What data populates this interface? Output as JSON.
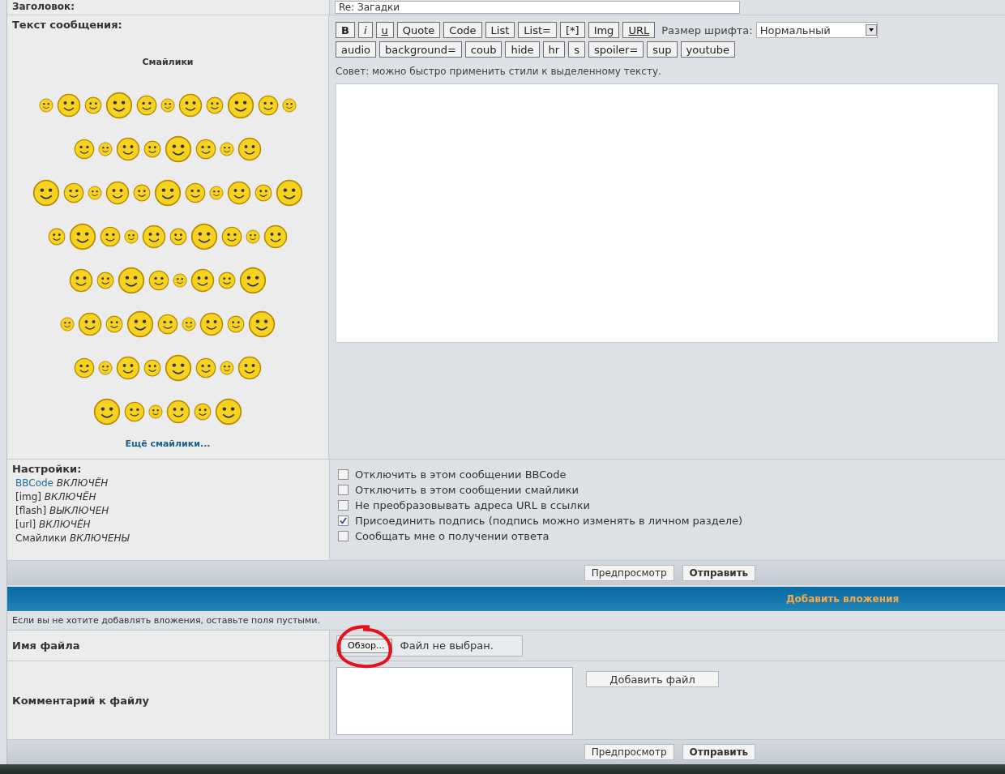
{
  "title_row": {
    "label": "Заголовок:",
    "value": "Re: Загадки"
  },
  "message": {
    "label": "Текст сообщения:",
    "smileys_heading": "Смайлики",
    "more_smileys": "Ещё смайлики...",
    "toolbar_rows": [
      [
        {
          "label": "B",
          "kind": "bold"
        },
        {
          "label": "i",
          "kind": "italic"
        },
        {
          "label": "u",
          "kind": "underline"
        },
        {
          "label": "Quote",
          "kind": "plain"
        },
        {
          "label": "Code",
          "kind": "plain"
        },
        {
          "label": "List",
          "kind": "plain"
        },
        {
          "label": "List=",
          "kind": "plain"
        },
        {
          "label": "[*]",
          "kind": "plain"
        },
        {
          "label": "Img",
          "kind": "plain"
        },
        {
          "label": "URL",
          "kind": "underline"
        }
      ],
      [
        {
          "label": "audio",
          "kind": "plain"
        },
        {
          "label": "background=",
          "kind": "plain"
        },
        {
          "label": "coub",
          "kind": "plain"
        },
        {
          "label": "hide",
          "kind": "plain"
        },
        {
          "label": "hr",
          "kind": "plain"
        },
        {
          "label": "s",
          "kind": "plain"
        },
        {
          "label": "spoiler=",
          "kind": "plain"
        },
        {
          "label": "sup",
          "kind": "plain"
        },
        {
          "label": "youtube",
          "kind": "plain"
        }
      ]
    ],
    "font_size_label": "Размер шрифта:",
    "font_size_value": "Нормальный",
    "tip": "Совет: можно быстро применить стили к выделенному тексту."
  },
  "settings": {
    "label": "Настройки:",
    "items": [
      {
        "name": "BBCode",
        "state": "ВКЛЮЧЁН",
        "link": true
      },
      {
        "name": "[img]",
        "state": "ВКЛЮЧЁН",
        "link": false
      },
      {
        "name": "[flash]",
        "state": "ВЫКЛЮЧЕН",
        "link": false
      },
      {
        "name": "[url]",
        "state": "ВКЛЮЧЁН",
        "link": false
      },
      {
        "name": "Смайлики",
        "state": "ВКЛЮЧЕНЫ",
        "link": false
      }
    ],
    "options": [
      {
        "label": "Отключить в этом сообщении BBCode",
        "checked": false
      },
      {
        "label": "Отключить в этом сообщении смайлики",
        "checked": false
      },
      {
        "label": "Не преобразовывать адреса URL в ссылки",
        "checked": false
      },
      {
        "label": "Присоединить подпись (подпись можно изменять в личном разделе)",
        "checked": true
      },
      {
        "label": "Сообщать мне о получении ответа",
        "checked": false
      }
    ]
  },
  "buttons_top": [
    "Предпросмотр",
    "Отправить"
  ],
  "attachments": {
    "header": "Добавить вложения",
    "note": "Если вы не хотите добавлять вложения, оставьте поля пустыми.",
    "file_label": "Имя файла",
    "browse": "Обзор...",
    "no_file": "Файл не выбран.",
    "comment_label": "Комментарий к файлу",
    "add_file": "Добавить файл"
  },
  "buttons_bottom": [
    "Предпросмотр",
    "Отправить"
  ]
}
